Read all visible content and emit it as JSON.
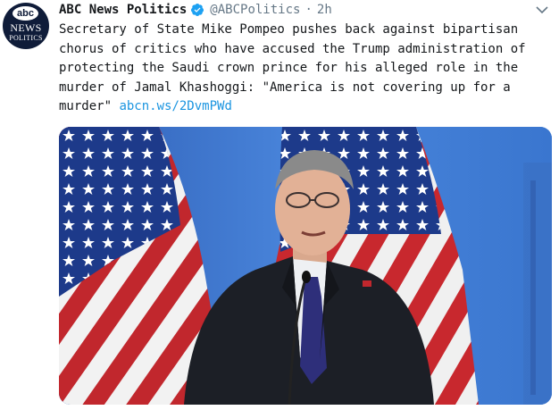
{
  "tweet": {
    "avatar": {
      "abc": "abc",
      "news": "NEWS",
      "politics": "POLITICS"
    },
    "display_name": "ABC News Politics",
    "handle": "@ABCPolitics",
    "separator": "·",
    "time": "2h",
    "text_lines": [
      "Secretary of State Mike Pompeo pushes back against bipartisan",
      "chorus of critics who have accused the Trump administration of",
      "protecting the Saudi crown prince for his alleged role in the",
      "murder of Jamal Khashoggi: \"America is not covering up for a"
    ],
    "last_line_prefix": "murder\" ",
    "link_text": "abcn.ws/2DvmPWd",
    "icons": {
      "verified": "verified-badge-icon",
      "caret": "chevron-down-icon"
    },
    "colors": {
      "link": "#1b95e0",
      "verified": "#1da1f2",
      "secondary": "#657786"
    }
  }
}
